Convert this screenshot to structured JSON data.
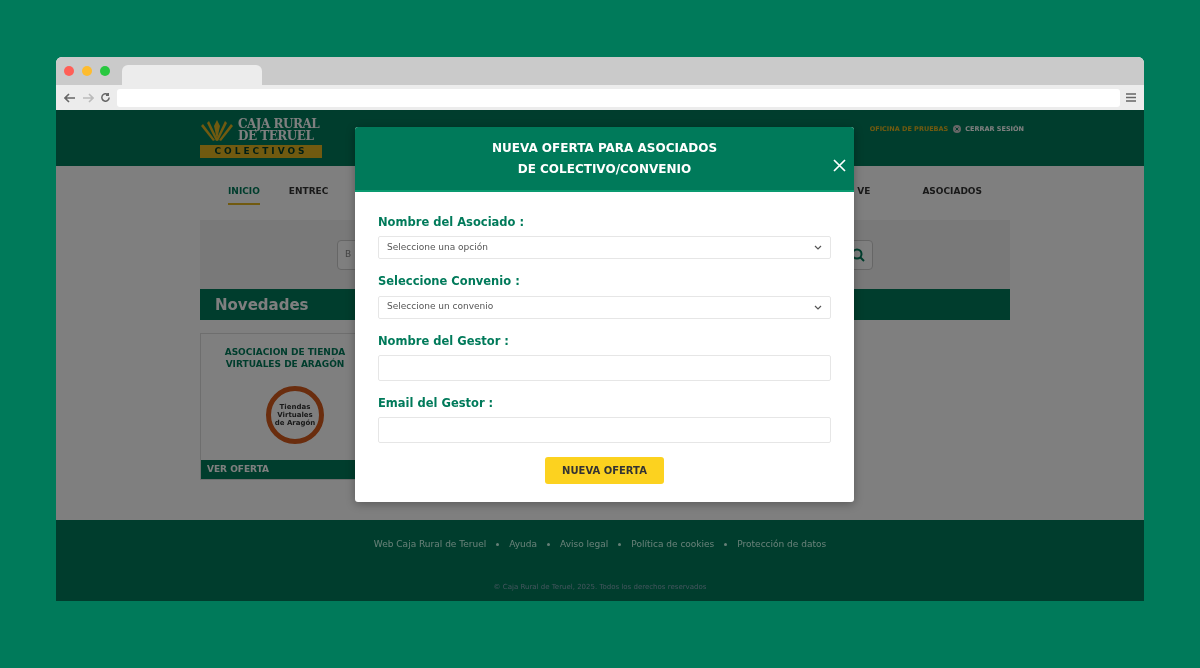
{
  "browser": {
    "dots": [
      {
        "color": "#ff5f57"
      },
      {
        "color": "#febc2e"
      },
      {
        "color": "#28c840"
      }
    ]
  },
  "site": {
    "logo": {
      "line1": "CAJA RURAL",
      "line2": "DE TERUEL",
      "band": "COLECTIVOS"
    },
    "office": "OFICINA DE PRUEBAS",
    "logout": "CERRAR SESIÓN",
    "nav": [
      {
        "label": "INICIO",
        "selected": true
      },
      {
        "label": "ENTREC",
        "selected": false
      },
      {
        "label": "VE",
        "selected": false
      },
      {
        "label": "ASOCIADOS",
        "selected": false
      }
    ],
    "search": {
      "placeholder": "B"
    },
    "section_title": "Novedades",
    "offer_card": {
      "title": "ASOCIACION DE TIENDA\nVIRTUALES DE ARAGÓN",
      "logo_lines": [
        "Tiendas",
        "Virtuales",
        "de Aragón"
      ],
      "action": "VER OFERTA"
    },
    "footer": {
      "links": [
        "Web Caja Rural de Teruel",
        "Ayuda",
        "Aviso legal",
        "Política de cookies",
        "Protección de datos"
      ],
      "copyright": "© Caja Rural de Teruel, 2025. Todos los derechos reservados"
    }
  },
  "modal": {
    "title": "NUEVA OFERTA PARA ASOCIADOS\nDE COLECTIVO/CONVENIO",
    "fields": [
      {
        "kind": "select",
        "label": "Nombre del Asociado :",
        "placeholder": "Seleccione una opción"
      },
      {
        "kind": "select",
        "label": "Seleccione Convenio :",
        "placeholder": "Seleccione un convenio"
      },
      {
        "kind": "text",
        "label": "Nombre del Gestor :"
      },
      {
        "kind": "text",
        "label": "Email del Gestor :"
      }
    ],
    "submit": "NUEVA OFERTA"
  }
}
